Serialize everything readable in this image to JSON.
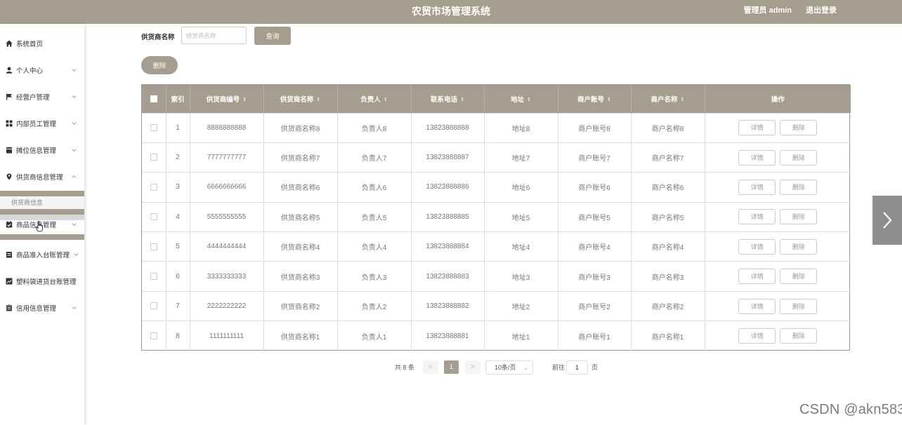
{
  "header": {
    "title": "农贸市场管理系统",
    "admin": "管理员 admin",
    "logout": "退出登录"
  },
  "sidebar": {
    "items": [
      {
        "label": "系统首页",
        "icon": "home-icon",
        "chevron": false
      },
      {
        "label": "个人中心",
        "icon": "user-icon",
        "chevron": true
      },
      {
        "label": "经营户管理",
        "icon": "flag-icon",
        "chevron": true
      },
      {
        "label": "内部员工管理",
        "icon": "grid-icon",
        "chevron": true
      },
      {
        "label": "摊位信息管理",
        "icon": "stall-icon",
        "chevron": true
      },
      {
        "label": "供货商信息管理",
        "icon": "location-pin-icon",
        "chevron": true,
        "expanded": true
      },
      {
        "label": "商品信息管理",
        "icon": "calendar-check-icon",
        "chevron": true
      },
      {
        "label": "商品准入台账管理",
        "icon": "ledger-icon",
        "chevron": true
      },
      {
        "label": "塑料袋进货台账管理",
        "icon": "chart-icon",
        "chevron": false
      },
      {
        "label": "信用信息管理",
        "icon": "document-icon",
        "chevron": true
      }
    ],
    "submenu": {
      "label": "供货商信息"
    }
  },
  "search": {
    "label": "供货商名称",
    "placeholder": "供货商名称",
    "query_button": "查询",
    "delete_button": "删除"
  },
  "table": {
    "headers": [
      "索引",
      "供货商编号",
      "供货商名称",
      "负责人",
      "联系电话",
      "地址",
      "商户账号",
      "商户名称",
      "操作"
    ],
    "detail_label": "详情",
    "delete_label": "删除",
    "rows": [
      [
        "1",
        "8888888888",
        "供货商名称8",
        "负责人8",
        "13823888888",
        "地址8",
        "商户账号8",
        "商户名称8"
      ],
      [
        "2",
        "7777777777",
        "供货商名称7",
        "负责人7",
        "13823888887",
        "地址7",
        "商户账号7",
        "商户名称7"
      ],
      [
        "3",
        "6666666666",
        "供货商名称6",
        "负责人6",
        "13823888886",
        "地址6",
        "商户账号6",
        "商户名称6"
      ],
      [
        "4",
        "5555555555",
        "供货商名称5",
        "负责人5",
        "13823888885",
        "地址5",
        "商户账号5",
        "商户名称5"
      ],
      [
        "5",
        "4444444444",
        "供货商名称4",
        "负责人4",
        "13823888884",
        "地址4",
        "商户账号4",
        "商户名称4"
      ],
      [
        "6",
        "3333333333",
        "供货商名称3",
        "负责人3",
        "13823888883",
        "地址3",
        "商户账号3",
        "商户名称3"
      ],
      [
        "7",
        "2222222222",
        "供货商名称2",
        "负责人2",
        "13823888882",
        "地址2",
        "商户账号2",
        "商户名称2"
      ],
      [
        "8",
        "1111111111",
        "供货商名称1",
        "负责人1",
        "13823888881",
        "地址1",
        "商户账号1",
        "商户名称1"
      ]
    ]
  },
  "pagination": {
    "total": "共 8 条",
    "prev": "<",
    "current": "1",
    "next": ">",
    "page_size": "10条/页",
    "goto": "前往",
    "goto_value": "1",
    "page_suffix": "页"
  },
  "watermark": "CSDN @akn583",
  "colors": {
    "accent": "#a59d8d",
    "text": "#333333",
    "muted": "#777777"
  }
}
